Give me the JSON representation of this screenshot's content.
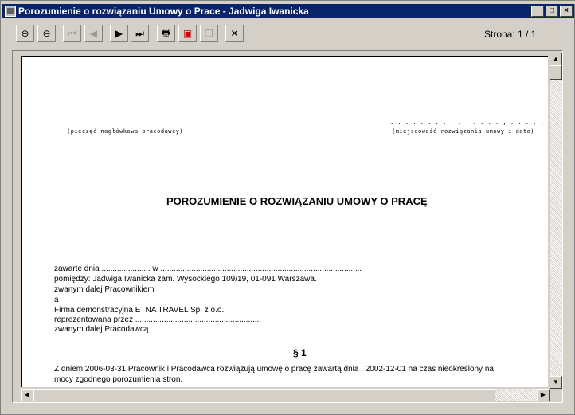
{
  "window": {
    "title": "Porozumienie o rozwiązaniu Umowy o Prace - Jadwiga Iwanicka",
    "minimize": "_",
    "maximize": "□",
    "close": "×"
  },
  "toolbar": {
    "page_indicator": "Strona: 1 / 1",
    "buttons": [
      {
        "name": "zoom-in",
        "glyph": "⊕"
      },
      {
        "name": "zoom-out",
        "glyph": "⊖"
      },
      {
        "name": "first-page",
        "glyph": "⏮"
      },
      {
        "name": "prev-page",
        "glyph": "◀"
      },
      {
        "name": "next-page",
        "glyph": "▶"
      },
      {
        "name": "last-page",
        "glyph": "⏭"
      },
      {
        "name": "print",
        "glyph": "🖶"
      },
      {
        "name": "export-pdf",
        "glyph": "▣"
      },
      {
        "name": "copy",
        "glyph": "❐"
      },
      {
        "name": "close",
        "glyph": "✕"
      }
    ]
  },
  "document": {
    "place_date_dots": ". . . . . . . . . . . . . . . ,  . . . . . . . . . . . .",
    "stamp_caption": "(pieczęć nagłówkowa pracodawcy)",
    "place_date_caption": "(miejscowość rozwiązania umowy i data)",
    "title": "POROZUMIENIE O ROZWIĄZANIU UMOWY O PRACĘ",
    "lines": [
      "zawarte dnia ...................... w ...........................................................................................",
      "pomiędzy: Jadwiga Iwanicka zam. Wysockiego 109/19, 01-091 Warszawa.",
      "zwanym dalej Pracownikiem",
      "a",
      "Firma demonstracyjna ETNA TRAVEL Sp. z o.o.",
      "reprezentowana przez .........................................................",
      "zwanym dalej Pracodawcą"
    ],
    "section": "§ 1",
    "paragraph_1": "Z dniem 2006-03-31 Pracownik i Pracodawca rozwiązują umowę o pracę zawartą dnia . 2002-12-01 na czas nieokreślony na",
    "paragraph_2": "mocy zgodnego porozumienia stron."
  }
}
